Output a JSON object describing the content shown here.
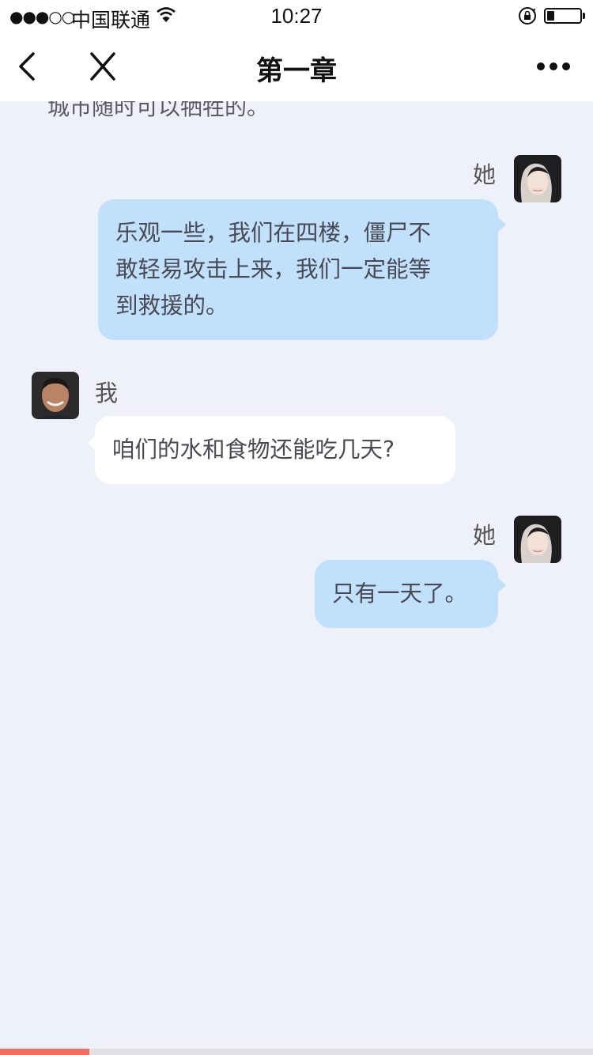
{
  "status_bar": {
    "signal": "●●●○○",
    "carrier": "中国联通",
    "time": "10:27"
  },
  "battery_level": 0.3,
  "nav": {
    "title": "第一章",
    "back_icon": "chevron-left-icon",
    "close_icon": "close-icon",
    "more_icon": "more-dots-icon"
  },
  "chat": {
    "partial_text": "城市随时可以牺牲的。",
    "messages": [
      {
        "sender": "她",
        "side": "her",
        "lines": [
          "乐观一些，我们在四楼，僵尸不",
          "敢轻易攻击上来，我们一定能等",
          "到救援的。"
        ]
      },
      {
        "sender": "我",
        "side": "me",
        "lines": [
          "咱们的水和食物还能吃几天?"
        ]
      },
      {
        "sender": "她",
        "side": "her",
        "lines": [
          "只有一天了。"
        ]
      }
    ]
  },
  "reading_progress": 0.15,
  "colors": {
    "page_bg": "#eef1fa",
    "her_bubble": "#c0e0fb",
    "my_bubble": "#ffffff",
    "progress": "#f16d62"
  }
}
